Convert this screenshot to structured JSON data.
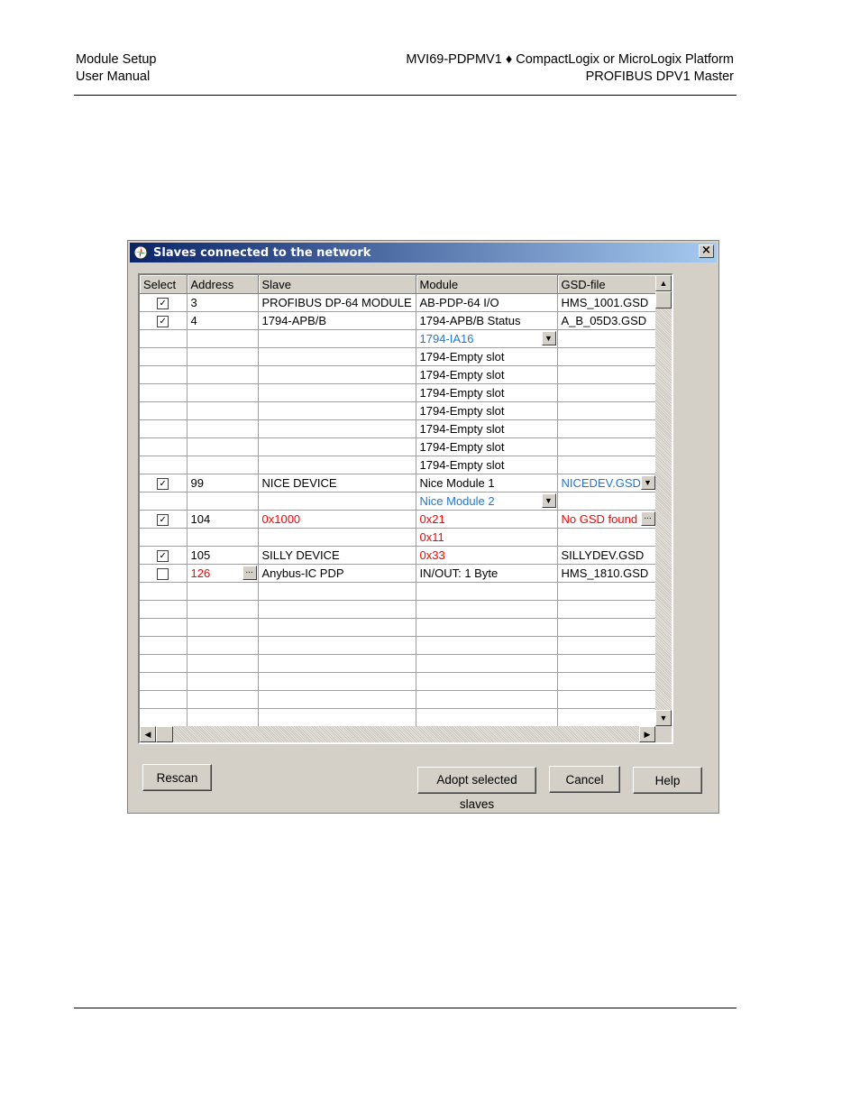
{
  "header": {
    "left_line1": "Module Setup",
    "left_line2": "User Manual",
    "right_line1": "MVI69-PDPMV1 ♦ CompactLogix or MicroLogix Platform",
    "right_line2": "PROFIBUS DPV1 Master"
  },
  "dialog": {
    "title": "Slaves connected to the network",
    "close_glyph": "×",
    "columns": [
      "Select",
      "Address",
      "Slave",
      "Module",
      "GSD-file"
    ],
    "rows": [
      {
        "select": "checked",
        "address": "3",
        "slave": "PROFIBUS DP-64 MODULE",
        "module": "AB-PDP-64 I/O",
        "gsd": "HMS_1001.GSD"
      },
      {
        "select": "checked",
        "address": "4",
        "slave": "1794-APB/B",
        "module": "1794-APB/B Status",
        "gsd": "A_B_05D3.GSD"
      },
      {
        "select": "",
        "address": "",
        "slave": "",
        "module": "1794-IA16",
        "module_style": "blue",
        "module_dropdown": true,
        "gsd": ""
      },
      {
        "select": "",
        "address": "",
        "slave": "",
        "module": "1794-Empty slot",
        "gsd": ""
      },
      {
        "select": "",
        "address": "",
        "slave": "",
        "module": "1794-Empty slot",
        "gsd": ""
      },
      {
        "select": "",
        "address": "",
        "slave": "",
        "module": "1794-Empty slot",
        "gsd": ""
      },
      {
        "select": "",
        "address": "",
        "slave": "",
        "module": "1794-Empty slot",
        "gsd": ""
      },
      {
        "select": "",
        "address": "",
        "slave": "",
        "module": "1794-Empty slot",
        "gsd": ""
      },
      {
        "select": "",
        "address": "",
        "slave": "",
        "module": "1794-Empty slot",
        "gsd": ""
      },
      {
        "select": "",
        "address": "",
        "slave": "",
        "module": "1794-Empty slot",
        "gsd": ""
      },
      {
        "select": "checked",
        "address": "99",
        "slave": "NICE DEVICE",
        "module": "Nice Module 1",
        "gsd": "NICEDEV.GSD",
        "gsd_style": "blue",
        "gsd_dropdown": true
      },
      {
        "select": "",
        "address": "",
        "slave": "",
        "module": "Nice Module 2",
        "module_style": "blue",
        "module_dropdown": true,
        "gsd": ""
      },
      {
        "select": "checked",
        "address": "104",
        "slave": "0x1000",
        "slave_style": "red",
        "module": "0x21",
        "module_style": "red",
        "gsd": "No GSD found",
        "gsd_style": "red",
        "gsd_ellipsis": true
      },
      {
        "select": "",
        "address": "",
        "slave": "",
        "module": "0x11",
        "module_style": "red",
        "gsd": ""
      },
      {
        "select": "checked",
        "address": "105",
        "slave": "SILLY DEVICE",
        "module": "0x33",
        "module_style": "red",
        "gsd": "SILLYDEV.GSD"
      },
      {
        "select": "unchecked",
        "address": "126",
        "address_style": "red",
        "address_ellipsis": true,
        "slave": "Anybus-IC PDP",
        "module": "IN/OUT: 1 Byte",
        "gsd": "HMS_1810.GSD"
      },
      {
        "select": "",
        "address": "",
        "slave": "",
        "module": "",
        "gsd": ""
      },
      {
        "select": "",
        "address": "",
        "slave": "",
        "module": "",
        "gsd": ""
      },
      {
        "select": "",
        "address": "",
        "slave": "",
        "module": "",
        "gsd": ""
      },
      {
        "select": "",
        "address": "",
        "slave": "",
        "module": "",
        "gsd": ""
      },
      {
        "select": "",
        "address": "",
        "slave": "",
        "module": "",
        "gsd": ""
      },
      {
        "select": "",
        "address": "",
        "slave": "",
        "module": "",
        "gsd": ""
      },
      {
        "select": "",
        "address": "",
        "slave": "",
        "module": "",
        "gsd": ""
      },
      {
        "select": "",
        "address": "",
        "slave": "",
        "module": "",
        "gsd": ""
      }
    ],
    "buttons": {
      "rescan": "Rescan",
      "adopt": "Adopt selected slaves",
      "cancel": "Cancel",
      "help": "Help"
    },
    "colors": {
      "red": "#ff0000",
      "blue": "#1e78d0",
      "title_start": "#0a246a",
      "title_end": "#a6caf0"
    },
    "icons": {
      "check": "✓",
      "dropdown": "▼",
      "ellipsis": "...",
      "scroll_up": "▲",
      "scroll_down": "▼",
      "scroll_left": "◀",
      "scroll_right": "▶"
    }
  }
}
